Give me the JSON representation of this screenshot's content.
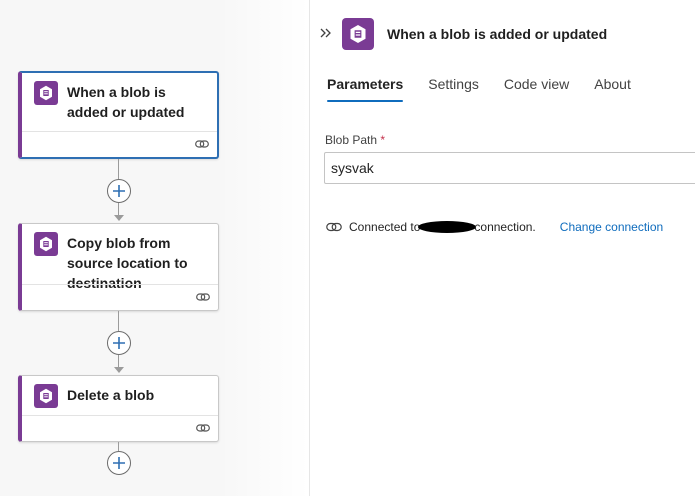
{
  "canvas": {
    "nodes": [
      {
        "title": "When a blob is added or updated",
        "selected": true,
        "icon": "azure-blob-storage-icon"
      },
      {
        "title": "Copy blob from source location to destination",
        "selected": false,
        "icon": "azure-blob-storage-icon"
      },
      {
        "title": "Delete a blob",
        "selected": false,
        "icon": "azure-blob-storage-icon"
      }
    ]
  },
  "panel": {
    "title": "When a blob is added or updated",
    "tabs": [
      "Parameters",
      "Settings",
      "Code view",
      "About"
    ],
    "active_tab": "Parameters",
    "field": {
      "label": "Blob Path",
      "required_mark": "*",
      "value": "sysvak"
    },
    "connection": {
      "prefix": "Connected to",
      "suffix": "connection.",
      "change_link": "Change connection"
    }
  },
  "colors": {
    "accent": "#0f6cbd",
    "brand_purple": "#7a3b94",
    "selected_border": "#2e6fb3"
  }
}
